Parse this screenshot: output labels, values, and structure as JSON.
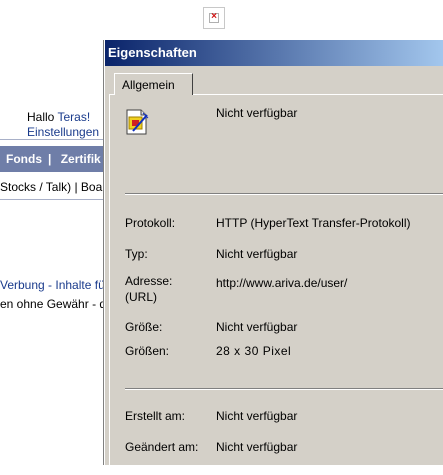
{
  "page": {
    "greeting": "Hallo",
    "user_name": "Teras!",
    "settings_link": "Einstellungen",
    "nav": [
      "Fonds",
      "Zertifik"
    ],
    "subnav": "Stocks / Talk) | Boa",
    "footer_links": "Verbung - Inhalte für",
    "footer_text": "en ohne Gewähr - d",
    "broken_image_icon": "broken-image-icon"
  },
  "dialog": {
    "title": "Eigenschaften",
    "tab": "Allgemein",
    "icon": "picture-file-icon",
    "name_value": "Nicht verfügbar",
    "rows": {
      "protokoll": {
        "label": "Protokoll:",
        "value": "HTTP (HyperText Transfer-Protokoll)"
      },
      "typ": {
        "label": "Typ:",
        "value": "Nicht verfügbar"
      },
      "adresse": {
        "label": "Adresse:",
        "label2": "(URL)",
        "value": "http://www.ariva.de/user/"
      },
      "groesse": {
        "label": "Größe:",
        "value": "Nicht verfügbar"
      },
      "groessen": {
        "label": "Größen:",
        "value": "28 x 30 Pixel"
      },
      "erstellt": {
        "label": "Erstellt am:",
        "value": "Nicht verfügbar"
      },
      "geaendert": {
        "label": "Geändert am:",
        "value": "Nicht verfügbar"
      }
    }
  },
  "colors": {
    "titlebar_start": "#0a246a",
    "titlebar_end": "#a6caf0",
    "dialog_bg": "#d4d0c8",
    "navbar": "#6f7ea8",
    "link": "#1a3b8c"
  }
}
